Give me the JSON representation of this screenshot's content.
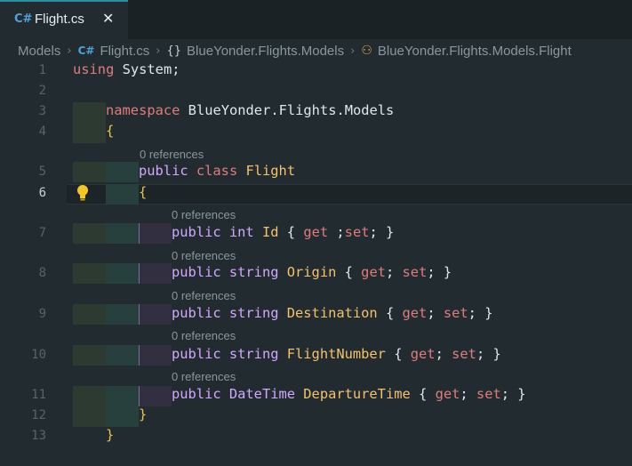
{
  "tab": {
    "icon": "csharp-file-icon",
    "label": "Flight.cs",
    "close": "✕"
  },
  "breadcrumb": {
    "folder": "Models",
    "file": "Flight.cs",
    "namespace": "BlueYonder.Flights.Models",
    "class": "BlueYonder.Flights.Models.Flight",
    "icons": [
      "csharp-file-icon",
      "namespace-braces-icon",
      "class-icon"
    ]
  },
  "editor": {
    "active_line": 6,
    "line_numbers": [
      "1",
      "2",
      "3",
      "4",
      "5",
      "6",
      "7",
      "8",
      "9",
      "10",
      "11",
      "12",
      "13"
    ],
    "lenses": {
      "class": "0 references",
      "p1": "0 references",
      "p2": "0 references",
      "p3": "0 references",
      "p4": "0 references",
      "p5": "0 references"
    },
    "tokens": {
      "l1_using": "using",
      "l1_system": " System;",
      "l3_namespace": "namespace",
      "l3_name": " BlueYonder.Flights.Models",
      "l4_open": "{",
      "l5_public": "public",
      "l5_class": " class",
      "l5_name": " Flight",
      "l6_open": "{",
      "l7_public": "public",
      "l7_type": " int",
      "l7_name": " Id",
      "l7_ob": " {",
      "l7_get": " get",
      "l7_semi": " ;",
      "l7_set": "set",
      "l7_rest": ";",
      "l7_cb": " }",
      "l8_public": "public",
      "l8_type": " string",
      "l8_name": " Origin",
      "l8_ob": " {",
      "l8_get": " get",
      "l8_semi": ";",
      "l8_set": " set",
      "l8_rest": ";",
      "l8_cb": " }",
      "l9_public": "public",
      "l9_type": " string",
      "l9_name": " Destination",
      "l9_ob": " {",
      "l9_get": " get",
      "l9_semi": ";",
      "l9_set": " set",
      "l9_rest": ";",
      "l9_cb": " }",
      "l10_public": "public",
      "l10_type": " string",
      "l10_name": " FlightNumber",
      "l10_ob": " {",
      "l10_get": " get",
      "l10_semi": ";",
      "l10_set": " set",
      "l10_rest": ";",
      "l10_cb": " }",
      "l11_public": "public",
      "l11_type": " DateTime",
      "l11_name": " DepartureTime",
      "l11_ob": " {",
      "l11_get": " get",
      "l11_semi": ";",
      "l11_set": " set",
      "l11_rest": ";",
      "l11_cb": " }",
      "l12_close": "}",
      "l13_close": "}"
    },
    "lightbulb_icon": "lightbulb-icon"
  },
  "colors": {
    "background": "#212b30",
    "tab_accent": "#2d8fa0",
    "keyword": "#e07c7c",
    "storage": "#d2a8ff",
    "type_name": "#f5c26b",
    "bracket": "#e8c547"
  }
}
